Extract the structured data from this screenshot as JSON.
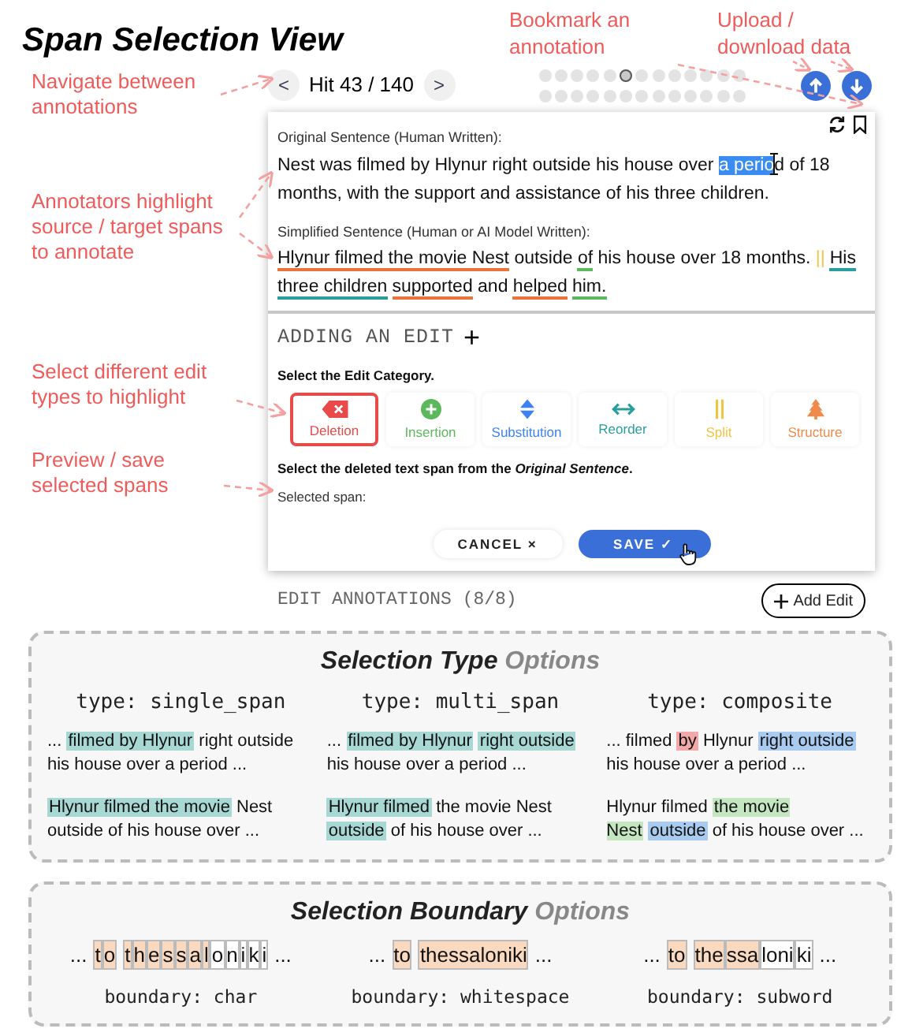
{
  "title": "Span Selection View",
  "callouts": [
    {
      "text": "Navigate between annotations"
    },
    {
      "text": "Annotators highlight source / target spans to annotate"
    },
    {
      "text": "Select different edit types to highlight"
    },
    {
      "text": "Preview / save selected spans"
    }
  ],
  "top_callouts": [
    {
      "text": "Bookmark an annotation"
    },
    {
      "text": "Upload / download data"
    }
  ],
  "navigation": {
    "prev": "<",
    "label": "Hit 43 / 140",
    "next": ">"
  },
  "hits": [
    {
      "selected": false
    },
    {
      "selected": false
    },
    {
      "selected": false
    },
    {
      "selected": false
    },
    {
      "selected": false
    },
    {
      "selected": true
    },
    {
      "selected": false
    },
    {
      "selected": false
    },
    {
      "selected": false
    },
    {
      "selected": false
    },
    {
      "selected": false
    },
    {
      "selected": false
    },
    {
      "selected": false
    },
    {
      "selected": false
    },
    {
      "selected": false
    },
    {
      "selected": false
    },
    {
      "selected": false
    },
    {
      "selected": false
    },
    {
      "selected": false
    },
    {
      "selected": false
    },
    {
      "selected": false
    },
    {
      "selected": false
    },
    {
      "selected": false
    },
    {
      "selected": false
    },
    {
      "selected": false
    },
    {
      "selected": false
    }
  ],
  "original": {
    "label": "Original Sentence (Human Written):",
    "segments": [
      {
        "text": "Nest was filmed by Hlynur right outside his house over "
      },
      {
        "text": "a perio",
        "selected": true
      },
      {
        "text": "d of 18 months, with the support and assistance of his three children."
      }
    ]
  },
  "simplified": {
    "label": "Simplified Sentence (Human or AI Model Written):",
    "segments": [
      {
        "text": "Hlynur filmed the movie Nest",
        "kind": "underline",
        "color": "#e8743b"
      },
      {
        "text": " outside "
      },
      {
        "text": "of",
        "kind": "underline",
        "color": "#5cb85c"
      },
      {
        "text": " his house over 18 months. "
      },
      {
        "text": "||",
        "kind": "mark",
        "color": "#f2c443",
        "space_after": true
      },
      {
        "text": "His three children",
        "kind": "underline",
        "color": "#2a9d9d",
        "space_after": true
      },
      {
        "text": "supported",
        "kind": "underline",
        "color": "#e8743b"
      },
      {
        "text": " and "
      },
      {
        "text": "helped",
        "kind": "underline",
        "color": "#e8743b",
        "space_after": true
      },
      {
        "text": "him.",
        "kind": "underline",
        "color": "#5cb85c"
      }
    ]
  },
  "edit": {
    "heading": "ADDING AN EDIT",
    "plus": "+",
    "category_prompt": "Select the Edit Category.",
    "categories": [
      {
        "label": "Deletion",
        "kind": "deletion",
        "color": "#e84a4a",
        "selected": true
      },
      {
        "label": "Insertion",
        "kind": "insertion",
        "color": "#5cb85c",
        "selected": false
      },
      {
        "label": "Substitution",
        "kind": "substitution",
        "color": "#3b82f6",
        "selected": false
      },
      {
        "label": "Reorder",
        "kind": "reorder",
        "color": "#2a9d9d",
        "selected": false
      },
      {
        "label": "Split",
        "kind": "split",
        "color": "#f2c443",
        "selected": false
      },
      {
        "label": "Structure",
        "kind": "structure",
        "color": "#ef8a4a",
        "selected": false
      }
    ],
    "span_prompt": "Select the deleted text span from the *Original Sentence*.",
    "selected_span_label": "Selected span:",
    "cancel": "CANCEL ×",
    "save": "SAVE ✓"
  },
  "edit_annotations": {
    "label": "EDIT ANNOTATIONS (8/8)",
    "add_button": "Add Edit"
  },
  "selection_type": {
    "title": "Selection Type",
    "title_suffix": "Options",
    "options": [
      {
        "type_label": "type: single_span",
        "source": [
          {
            "text": "... "
          },
          {
            "text": "filmed by Hlynur",
            "color": "#a8d8d4"
          },
          {
            "text": " right outside his house over a period ..."
          }
        ],
        "target": [
          {
            "text": "Hlynur filmed the movie",
            "color": "#a8d8d4"
          },
          {
            "text": " Nest outside of his house over ..."
          }
        ]
      },
      {
        "type_label": "type: multi_span",
        "source": [
          {
            "text": "... "
          },
          {
            "text": "filmed by Hlynur",
            "color": "#a8d8d4",
            "space_after": true
          },
          {
            "text": "right outside",
            "color": "#a8d8d4"
          },
          {
            "text": " his house over a period ..."
          }
        ],
        "target": [
          {
            "text": "Hlynur filmed",
            "color": "#a8d8d4"
          },
          {
            "text": " the movie Nest "
          },
          {
            "text": "outside",
            "color": "#a8d8d4"
          },
          {
            "text": " of his house over ..."
          }
        ]
      },
      {
        "type_label": "type: composite",
        "source": [
          {
            "text": "... filmed "
          },
          {
            "text": "by",
            "color": "#f2a9a9"
          },
          {
            "text": " Hlynur "
          },
          {
            "text": "right outside",
            "color": "#a9cbf0"
          },
          {
            "text": " his house over a period ..."
          }
        ],
        "target": [
          {
            "text": "Hlynur filmed "
          },
          {
            "text": "the movie Nest",
            "color": "#c4e6c0",
            "space_after": true
          },
          {
            "text": "outside",
            "color": "#a9cbf0"
          },
          {
            "text": " of his house over ..."
          }
        ]
      }
    ]
  },
  "selection_boundary": {
    "title": "Selection Boundary",
    "title_suffix": "Options",
    "options": [
      {
        "label": "boundary: char",
        "prefix": "...",
        "suffix": "...",
        "words": [
          {
            "cells": [
              {
                "text": "t",
                "selected": true
              },
              {
                "text": "o",
                "selected": true
              }
            ]
          },
          {
            "cells": [
              {
                "text": "t",
                "selected": true
              },
              {
                "text": "h",
                "selected": true
              },
              {
                "text": "e",
                "selected": true
              },
              {
                "text": "s",
                "selected": true
              },
              {
                "text": "s",
                "selected": true
              },
              {
                "text": "a",
                "selected": true
              },
              {
                "text": "l",
                "selected": true
              },
              {
                "text": "o",
                "selected": false
              },
              {
                "text": "n",
                "selected": false
              },
              {
                "text": "i",
                "selected": false
              },
              {
                "text": "k",
                "selected": false
              },
              {
                "text": "i",
                "selected": false
              }
            ]
          }
        ]
      },
      {
        "label": "boundary: whitespace",
        "prefix": "...",
        "suffix": "...",
        "words": [
          {
            "cells": [
              {
                "text": "to",
                "selected": true
              }
            ]
          },
          {
            "cells": [
              {
                "text": "thessaloniki",
                "selected": true
              }
            ]
          }
        ]
      },
      {
        "label": "boundary: subword",
        "prefix": "...",
        "suffix": "...",
        "words": [
          {
            "cells": [
              {
                "text": "to",
                "selected": true
              }
            ]
          },
          {
            "cells": [
              {
                "text": "the",
                "selected": true
              },
              {
                "text": "ssa",
                "selected": true
              },
              {
                "text": "loni",
                "selected": false
              },
              {
                "text": "ki",
                "selected": false
              }
            ]
          }
        ]
      }
    ]
  }
}
